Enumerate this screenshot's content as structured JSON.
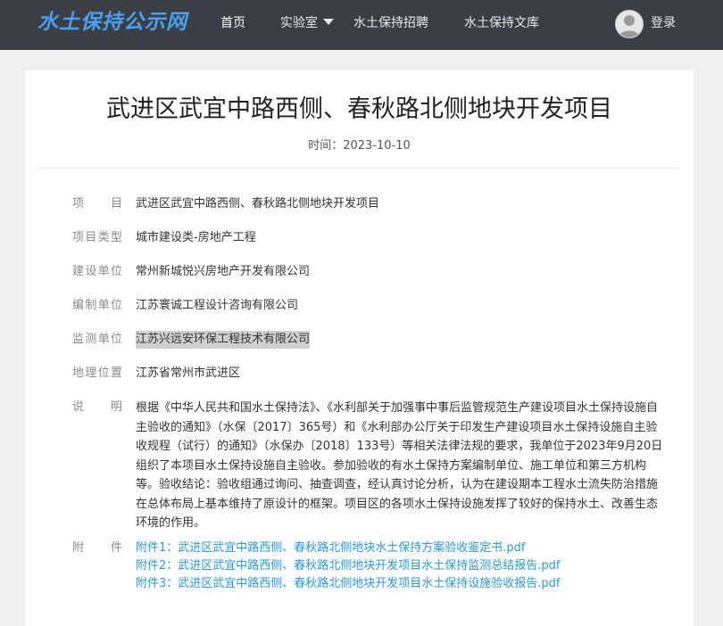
{
  "header": {
    "logo": "水土保持公示网",
    "nav": [
      "首页",
      "实验室",
      "水土保持招聘",
      "水土保持文库"
    ],
    "login": "登录"
  },
  "article": {
    "title": "武进区武宜中路西侧、春秋路北侧地块开发项目",
    "time": "时间：2023-10-10",
    "fields": [
      {
        "label": "项目",
        "value": "武进区武宜中路西侧、春秋路北侧地块开发项目"
      },
      {
        "label": "项目类型",
        "value": "城市建设类-房地产工程"
      },
      {
        "label": "建设单位",
        "value": "常州新城悦兴房地产开发有限公司"
      },
      {
        "label": "编制单位",
        "value": "江苏寰诚工程设计咨询有限公司"
      },
      {
        "label": "监测单位",
        "value": "江苏兴远安环保工程技术有限公司"
      },
      {
        "label": "地理位置",
        "value": "江苏省常州市武进区"
      }
    ],
    "description_label": "说明",
    "description": "根据《中华人民共和国水土保持法》、《水利部关于加强事中事后监管规范生产建设项目水土保持设施自主验收的通知》（水保〔2017〕365号）和《水利部办公厅关于印发生产建设项目水土保持设施自主验收规程（试行）的通知》（水保办〔2018〕133号）等相关法律法规的要求，我单位于2023年9月20日组织了本项目水土保持设施自主验收。参加验收的有水土保持方案编制单位、施工单位和第三方机构等。验收结论：验收组通过询问、抽查调查，经认真讨论分析，认为在建设期本工程水土流失防治措施在总体布局上基本维持了原设计的框架。项目区的各项水土保持设施发挥了较好的保持水土、改善生态环境的作用。",
    "attachments_label": "附件",
    "attachments": [
      "附件1：武进区武宜中路西侧、春秋路北侧地块水土保持方案验收鉴定书.pdf",
      "附件2：武进区武宜中路西侧、春秋路北侧地块开发项目水土保持监测总结报告.pdf",
      "附件3：武进区武宜中路西侧、春秋路北侧地块开发项目水土保持设施验收报告.pdf"
    ]
  },
  "colors": {
    "topbar": "#3b3e45",
    "logo": "#4a9ff0",
    "link": "#2b9ad8",
    "label": "#8a8a8a"
  },
  "icons": [
    "caret-down-icon",
    "user-avatar-icon"
  ]
}
